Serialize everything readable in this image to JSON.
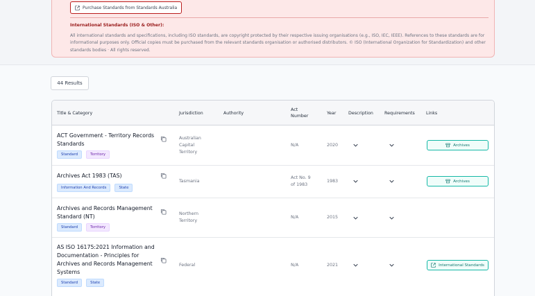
{
  "notice": {
    "purchase_button": "Purchase Standards from Standards Australia",
    "title": "International Standards (ISO & Other):",
    "text": "All international standards and specifications, including ISO standards, are copyright protected by their respective issuing organisations (e.g., ISO, IEC, IEEE). References to these standards are for informational purposes only. Official copies must be purchased from the relevant standards organisation or authorised distributors. © ISO (International Organization for Standardization) and other standards bodies · All rights reserved."
  },
  "results": {
    "label": "44 Results"
  },
  "table": {
    "headers": {
      "title": "Title & Category",
      "jurisdiction": "Jurisdiction",
      "authority": "Authority",
      "act_number": "Act Number",
      "year": "Year",
      "description": "Description",
      "requirements": "Requirements",
      "links": "Links"
    },
    "rows": [
      {
        "title": "ACT Government - Territory Records Standards",
        "tags": [
          "Standard",
          "Territory"
        ],
        "jurisdiction": "Australian Capital Territory",
        "act_number": "N/A",
        "year": "2020",
        "link": "Archives"
      },
      {
        "title": "Archives Act 1983 (TAS)",
        "tags": [
          "Information And Records",
          "State"
        ],
        "jurisdiction": "Tasmania",
        "act_number": "Act No. 9 of 1983",
        "year": "1983",
        "link": "Archives"
      },
      {
        "title": "Archives and Records Management Standard (NT)",
        "tags": [
          "Standard",
          "Territory"
        ],
        "jurisdiction": "Northern Territory",
        "act_number": "N/A",
        "year": "2015",
        "link": ""
      },
      {
        "title": "AS ISO 16175:2021 Information and Documentation - Principles for Archives and Records Management Systems",
        "tags": [
          "Standard",
          "State"
        ],
        "jurisdiction": "Federal",
        "act_number": "N/A",
        "year": "2021",
        "link": "International Standards"
      }
    ]
  },
  "colors": {
    "notice_bg": "#fde8e8",
    "notice_title": "#991b1b",
    "link_accent": "#14b8a6",
    "tag_blue": "#dbeafe",
    "tag_purple": "#f3e8ff"
  }
}
